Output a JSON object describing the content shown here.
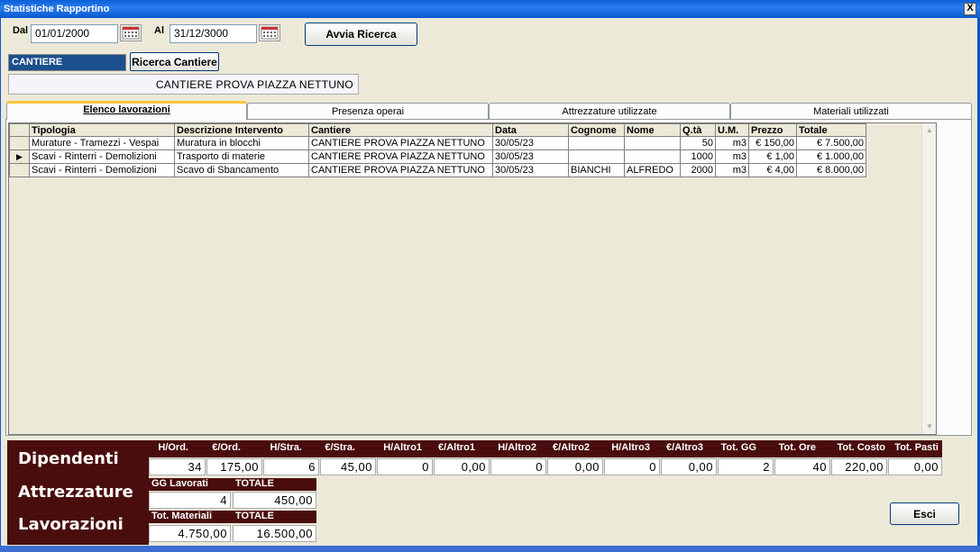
{
  "window": {
    "title": "Statistiche Rapportino",
    "close_glyph": "X"
  },
  "filters": {
    "dal_label": "Dal",
    "dal_value": "01/01/2000",
    "al_label": "Al",
    "al_value": "31/12/3000",
    "search_button": "Avvia Ricerca"
  },
  "cantiere": {
    "label": "CANTIERE",
    "search_button": "Ricerca Cantiere",
    "selected": "CANTIERE PROVA PIAZZA NETTUNO"
  },
  "tabs": [
    {
      "label": "Elenco lavorazioni",
      "active": true
    },
    {
      "label": "Presenza operai",
      "active": false
    },
    {
      "label": "Attrezzature utilizzate",
      "active": false
    },
    {
      "label": "Materiali utilizzati",
      "active": false
    }
  ],
  "grid": {
    "columns": [
      "Tipologia",
      "Descrizione Intervento",
      "Cantiere",
      "Data",
      "Cognome",
      "Nome",
      "Q.tà",
      "U.M.",
      "Prezzo",
      "Totale"
    ],
    "rows": [
      [
        "Murature - Tramezzi - Vespai",
        "Muratura in blocchi",
        "CANTIERE PROVA PIAZZA NETTUNO",
        "30/05/23",
        "",
        "",
        "50",
        "m3",
        "€ 150,00",
        "€ 7.500,00"
      ],
      [
        "Scavi - Rinterri - Demolizioni",
        "Trasporto di materie",
        "CANTIERE PROVA PIAZZA NETTUNO",
        "30/05/23",
        "",
        "",
        "1000",
        "m3",
        "€ 1,00",
        "€ 1.000,00"
      ],
      [
        "Scavi - Rinterri - Demolizioni",
        "Scavo di Sbancamento",
        "CANTIERE PROVA PIAZZA NETTUNO",
        "30/05/23",
        "BIANCHI",
        "ALFREDO",
        "2000",
        "m3",
        "€ 4,00",
        "€ 8.000,00"
      ]
    ],
    "current_row_indicator": "▶"
  },
  "summary": {
    "dipendenti": {
      "label": "Dipendenti",
      "headers": [
        "H/Ord.",
        "€/Ord.",
        "H/Stra.",
        "€/Stra.",
        "H/Altro1",
        "€/Altro1",
        "H/Altro2",
        "€/Altro2",
        "H/Altro3",
        "€/Altro3",
        "Tot. GG",
        "Tot. Ore",
        "Tot. Costo",
        "Tot. Pasti"
      ],
      "values": [
        "34",
        "175,00",
        "6",
        "45,00",
        "0",
        "0,00",
        "0",
        "0,00",
        "0",
        "0,00",
        "2",
        "40",
        "220,00",
        "0,00"
      ]
    },
    "attrezzature": {
      "label": "Attrezzature",
      "headers": [
        "GG Lavorati",
        "TOTALE"
      ],
      "values": [
        "4",
        "450,00"
      ]
    },
    "lavorazioni": {
      "label": "Lavorazioni",
      "headers": [
        "Tot. Materiali",
        "TOTALE"
      ],
      "values": [
        "4.750,00",
        "16.500,00"
      ]
    }
  },
  "exit_button": "Esci"
}
